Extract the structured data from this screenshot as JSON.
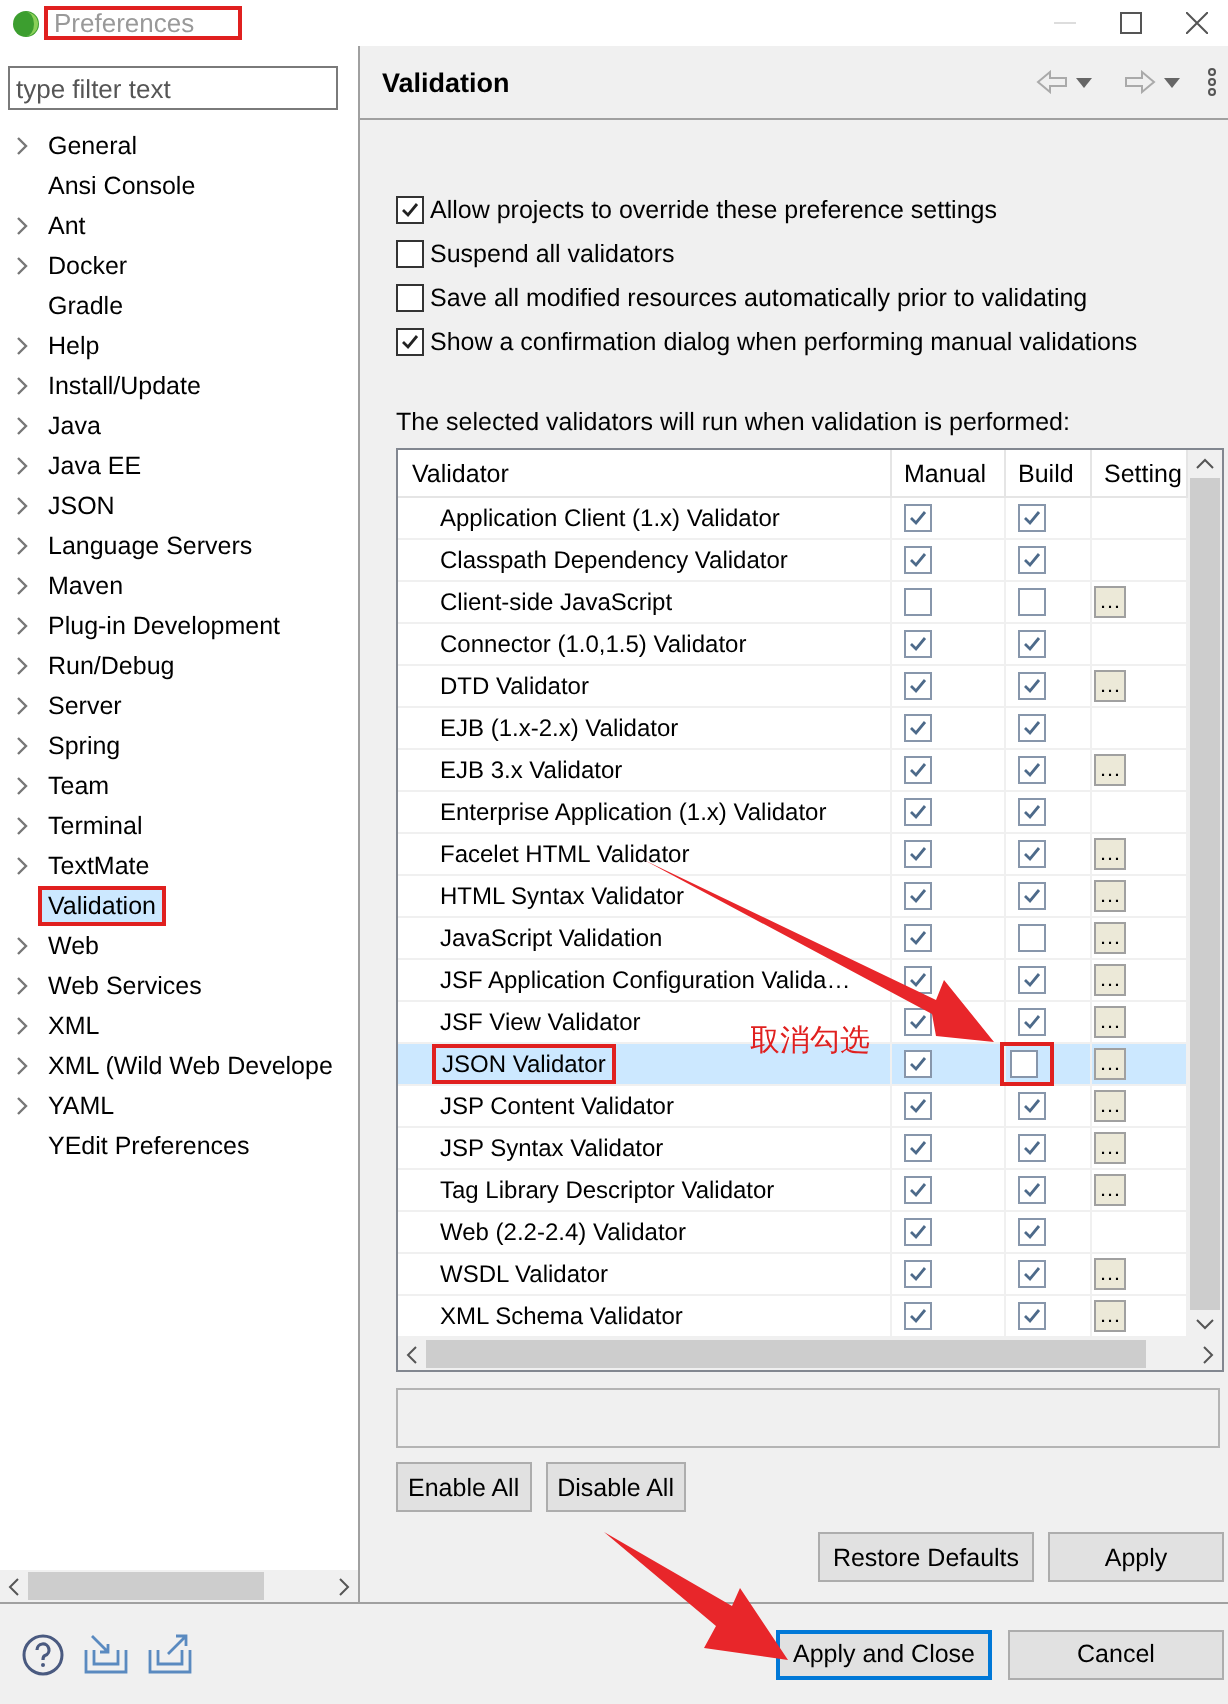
{
  "window": {
    "title": "Preferences",
    "title_marked": true
  },
  "filter": {
    "placeholder": "type filter text"
  },
  "tree": {
    "items": [
      {
        "label": "General",
        "expandable": true,
        "selected": false,
        "marked": false
      },
      {
        "label": "Ansi Console",
        "expandable": false,
        "selected": false,
        "marked": false
      },
      {
        "label": "Ant",
        "expandable": true,
        "selected": false,
        "marked": false
      },
      {
        "label": "Docker",
        "expandable": true,
        "selected": false,
        "marked": false
      },
      {
        "label": "Gradle",
        "expandable": false,
        "selected": false,
        "marked": false
      },
      {
        "label": "Help",
        "expandable": true,
        "selected": false,
        "marked": false
      },
      {
        "label": "Install/Update",
        "expandable": true,
        "selected": false,
        "marked": false
      },
      {
        "label": "Java",
        "expandable": true,
        "selected": false,
        "marked": false
      },
      {
        "label": "Java EE",
        "expandable": true,
        "selected": false,
        "marked": false
      },
      {
        "label": "JSON",
        "expandable": true,
        "selected": false,
        "marked": false
      },
      {
        "label": "Language Servers",
        "expandable": true,
        "selected": false,
        "marked": false
      },
      {
        "label": "Maven",
        "expandable": true,
        "selected": false,
        "marked": false
      },
      {
        "label": "Plug-in Development",
        "expandable": true,
        "selected": false,
        "marked": false
      },
      {
        "label": "Run/Debug",
        "expandable": true,
        "selected": false,
        "marked": false
      },
      {
        "label": "Server",
        "expandable": true,
        "selected": false,
        "marked": false
      },
      {
        "label": "Spring",
        "expandable": true,
        "selected": false,
        "marked": false
      },
      {
        "label": "Team",
        "expandable": true,
        "selected": false,
        "marked": false
      },
      {
        "label": "Terminal",
        "expandable": true,
        "selected": false,
        "marked": false
      },
      {
        "label": "TextMate",
        "expandable": true,
        "selected": false,
        "marked": false
      },
      {
        "label": "Validation",
        "expandable": false,
        "selected": true,
        "marked": true
      },
      {
        "label": "Web",
        "expandable": true,
        "selected": false,
        "marked": false
      },
      {
        "label": "Web Services",
        "expandable": true,
        "selected": false,
        "marked": false
      },
      {
        "label": "XML",
        "expandable": true,
        "selected": false,
        "marked": false
      },
      {
        "label": "XML (Wild Web Develope",
        "expandable": true,
        "selected": false,
        "marked": false
      },
      {
        "label": "YAML",
        "expandable": true,
        "selected": false,
        "marked": false
      },
      {
        "label": "YEdit Preferences",
        "expandable": false,
        "selected": false,
        "marked": false
      }
    ]
  },
  "page": {
    "title": "Validation"
  },
  "options": [
    {
      "label": "Allow projects to override these preference settings",
      "checked": true
    },
    {
      "label": "Suspend all validators",
      "checked": false
    },
    {
      "label": "Save all modified resources automatically prior to validating",
      "checked": false
    },
    {
      "label": "Show a confirmation dialog when performing manual validations",
      "checked": true
    }
  ],
  "table_caption": "The selected validators will run when validation is performed:",
  "table": {
    "columns": [
      "Validator",
      "Manual",
      "Build",
      "Setting"
    ],
    "rows": [
      {
        "name": "Application Client (1.x) Validator",
        "manual": true,
        "build": true,
        "selected": false,
        "annotated": false
      },
      {
        "name": "Classpath Dependency Validator",
        "manual": true,
        "build": true,
        "selected": false,
        "annotated": false
      },
      {
        "name": "Client-side JavaScript",
        "manual": false,
        "build": false,
        "settings": "…",
        "selected": false,
        "annotated": false
      },
      {
        "name": "Connector (1.0,1.5) Validator",
        "manual": true,
        "build": true,
        "selected": false,
        "annotated": false
      },
      {
        "name": "DTD Validator",
        "manual": true,
        "build": true,
        "settings": "…",
        "selected": false,
        "annotated": false
      },
      {
        "name": "EJB (1.x-2.x) Validator",
        "manual": true,
        "build": true,
        "selected": false,
        "annotated": false
      },
      {
        "name": "EJB 3.x Validator",
        "manual": true,
        "build": true,
        "settings": "…",
        "selected": false,
        "annotated": false
      },
      {
        "name": "Enterprise Application (1.x) Validator",
        "manual": true,
        "build": true,
        "selected": false,
        "annotated": false
      },
      {
        "name": "Facelet HTML Validator",
        "manual": true,
        "build": true,
        "settings": "…",
        "selected": false,
        "annotated": false
      },
      {
        "name": "HTML Syntax Validator",
        "manual": true,
        "build": true,
        "settings": "…",
        "selected": false,
        "annotated": false
      },
      {
        "name": "JavaScript Validation",
        "manual": true,
        "build": false,
        "settings": "…",
        "selected": false,
        "annotated": false
      },
      {
        "name": "JSF Application Configuration Valida…",
        "manual": true,
        "build": true,
        "settings": "…",
        "selected": false,
        "annotated": false
      },
      {
        "name": "JSF View Validator",
        "manual": true,
        "build": true,
        "settings": "…",
        "selected": false,
        "annotated": false
      },
      {
        "name": "JSON Validator",
        "manual": true,
        "build": false,
        "settings": "…",
        "selected": true,
        "annotated": true
      },
      {
        "name": "JSP Content Validator",
        "manual": true,
        "build": true,
        "settings": "…",
        "selected": false,
        "annotated": false
      },
      {
        "name": "JSP Syntax Validator",
        "manual": true,
        "build": true,
        "settings": "…",
        "selected": false,
        "annotated": false
      },
      {
        "name": "Tag Library Descriptor Validator",
        "manual": true,
        "build": true,
        "settings": "…",
        "selected": false,
        "annotated": false
      },
      {
        "name": "Web (2.2-2.4) Validator",
        "manual": true,
        "build": true,
        "selected": false,
        "annotated": false
      },
      {
        "name": "WSDL Validator",
        "manual": true,
        "build": true,
        "settings": "…",
        "selected": false,
        "annotated": false
      },
      {
        "name": "XML Schema Validator",
        "manual": true,
        "build": true,
        "settings": "…",
        "selected": false,
        "annotated": false
      }
    ]
  },
  "table_buttons": [
    "Enable All",
    "Disable All"
  ],
  "page_buttons": [
    "Restore Defaults",
    "Apply"
  ],
  "dialog_buttons": [
    {
      "label": "Apply and Close",
      "default": true
    },
    {
      "label": "Cancel",
      "default": false
    }
  ],
  "annotation": {
    "note": "取消勾选"
  }
}
